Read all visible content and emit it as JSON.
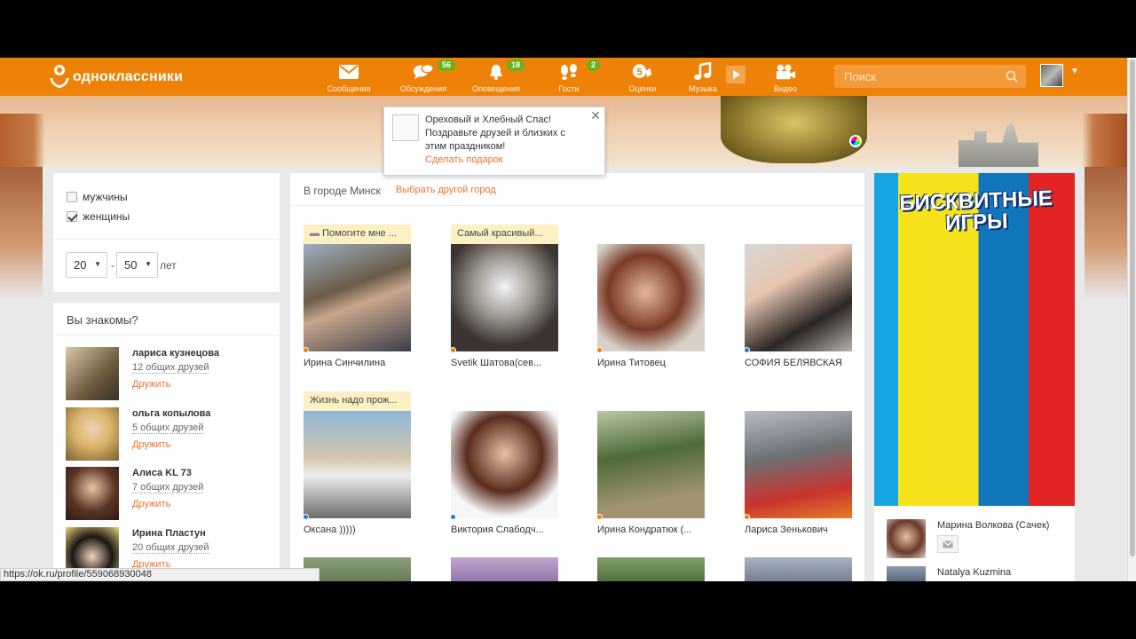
{
  "app": {
    "logo_text": "одноклассники"
  },
  "nav": [
    {
      "label": "Сообщения",
      "icon": "envelope-icon",
      "badge": ""
    },
    {
      "label": "Обсуждения",
      "icon": "chat-bubbles-icon",
      "badge": "56"
    },
    {
      "label": "Оповещения",
      "icon": "bell-icon",
      "badge": "18"
    },
    {
      "label": "Гости",
      "icon": "footprints-icon",
      "badge": "2"
    },
    {
      "label": "Оценки",
      "icon": "rating-icon",
      "badge": ""
    },
    {
      "label": "Музыка",
      "icon": "music-note-icon",
      "badge": ""
    },
    {
      "label": "Видео",
      "icon": "video-camera-icon",
      "badge": ""
    }
  ],
  "search": {
    "placeholder": "Поиск"
  },
  "popup": {
    "text": "Ореховый и Хлебный Спас! Поздравьте друзей и близких с этим праздником!",
    "link": "Сделать подарок",
    "close": "✕"
  },
  "filters": {
    "gender": [
      {
        "label": "мужчины",
        "checked": false
      },
      {
        "label": "женщины",
        "checked": true
      }
    ],
    "age_from": "20",
    "age_to": "50",
    "dash": "-",
    "age_unit": "лет"
  },
  "know": {
    "title": "Вы знакомы?",
    "people": [
      {
        "name": "лариса кузнецова",
        "mutual": "12 общих друзей",
        "action": "Дружить"
      },
      {
        "name": "ольга копылова",
        "mutual": "5 общих друзей",
        "action": "Дружить"
      },
      {
        "name": "Алиса KL 73",
        "mutual": "7 общих друзей",
        "action": "Дружить"
      },
      {
        "name": "Ирина Пластун",
        "mutual": "20 общих друзей",
        "action": "Дружить"
      }
    ]
  },
  "center": {
    "city_label": "В городе Минск",
    "change_city": "Выбрать другой город",
    "cards": [
      {
        "tag": "Помогите мне ...",
        "name": "Ирина Синчилина"
      },
      {
        "tag": "Самый красивый...",
        "name": "Svetik Шатова(сев..."
      },
      {
        "tag": "",
        "name": "Ирина Титовец"
      },
      {
        "tag": "",
        "name": "СОФИЯ БЕЛЯВСКАЯ"
      },
      {
        "tag": "Жизнь надо прож...",
        "name": "Оксана )))))"
      },
      {
        "tag": "",
        "name": "Виктория Слабодч..."
      },
      {
        "tag": "",
        "name": "Ирина Кондратюк (..."
      },
      {
        "tag": "",
        "name": "Лариса Зенькович"
      }
    ]
  },
  "ad": {
    "title": "БИСКВИТНЫЕ ИГРЫ"
  },
  "right_people": [
    {
      "name": "Марина Волкова (Сачек)"
    },
    {
      "name": "Natalya Kuzmina"
    }
  ],
  "status_url": "https://ok.ru/profile/559068930048",
  "colors": {
    "brand": "#ee8208",
    "link": "#eb722e",
    "badge": "#67b21b"
  }
}
